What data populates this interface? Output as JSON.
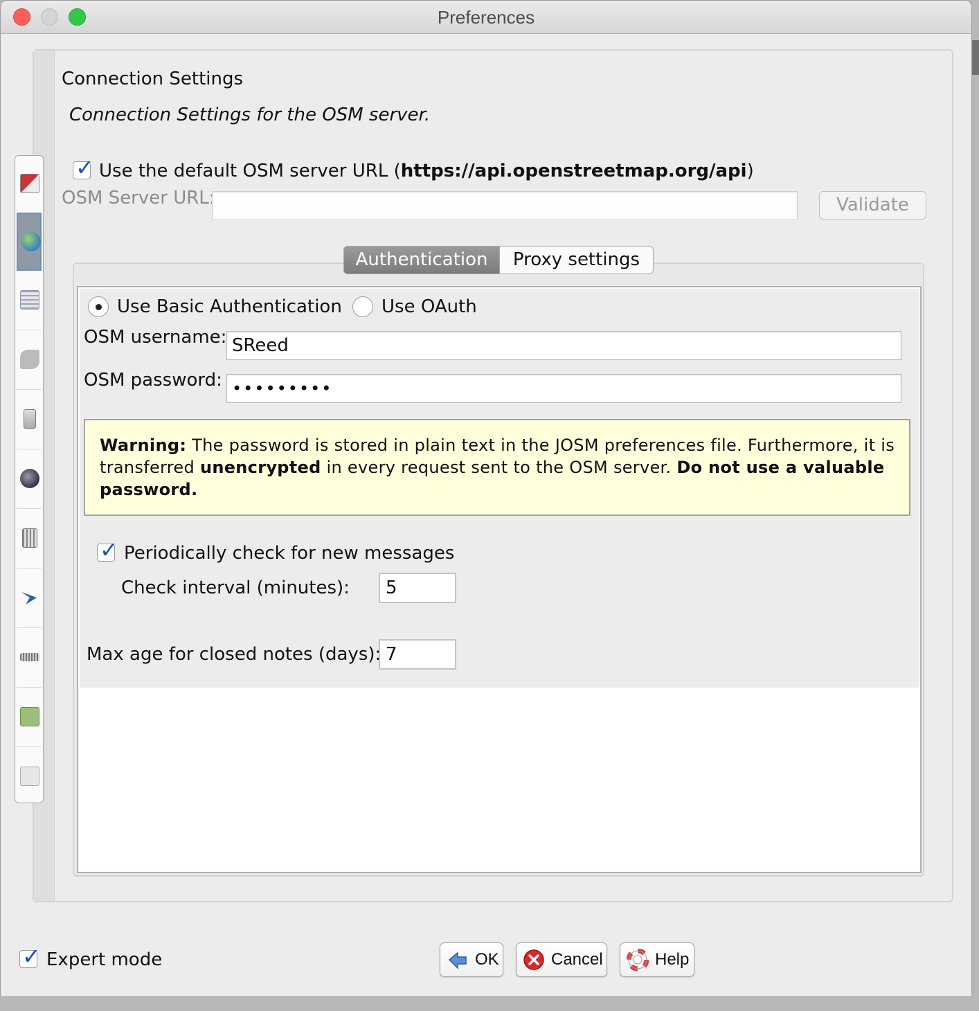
{
  "window": {
    "title": "Preferences"
  },
  "header": {
    "title": "Connection Settings",
    "subtitle": "Connection Settings for the OSM server."
  },
  "server": {
    "use_default_prefix": "Use the default OSM server URL (",
    "default_url": "https://api.openstreetmap.org/api",
    "use_default_suffix": ")",
    "use_default_checked": true,
    "url_label": "OSM Server URL:",
    "url_value": "",
    "validate_label": "Validate"
  },
  "tabs": [
    {
      "label": "Authentication",
      "selected": true
    },
    {
      "label": "Proxy settings",
      "selected": false
    }
  ],
  "auth": {
    "basic_label": "Use Basic Authentication",
    "oauth_label": "Use OAuth",
    "basic_selected": true,
    "username_label": "OSM username:",
    "username_value": "SReed",
    "password_label": "OSM password:",
    "password_value": "•••••••••",
    "warning": {
      "w_bold": "Warning:",
      "w_text1": " The password is stored in plain text in the JOSM preferences file. Furthermore, it is transferred ",
      "w_bold2": "unencrypted",
      "w_text2": " in every request sent to the OSM server. ",
      "w_bold3": "Do not use a valuable password."
    }
  },
  "messages": {
    "periodic_label": "Periodically check for new messages",
    "periodic_checked": true,
    "interval_label": "Check interval (minutes):",
    "interval_value": "5",
    "max_age_label": "Max age for closed notes (days):",
    "max_age_value": "7"
  },
  "sidebar": {
    "items": [
      {
        "icon": "display-settings-icon"
      },
      {
        "icon": "connection-globe-icon",
        "selected": true
      },
      {
        "icon": "map-grid-icon"
      },
      {
        "icon": "map-paint-styles-icon"
      },
      {
        "icon": "tagging-presets-icon"
      },
      {
        "icon": "remote-control-icon"
      },
      {
        "icon": "shortcuts-keyboard-icon"
      },
      {
        "icon": "validator-arrow-icon"
      },
      {
        "icon": "audio-settings-icon"
      },
      {
        "icon": "wms-tms-icon"
      },
      {
        "icon": "plugins-icon"
      }
    ]
  },
  "footer": {
    "expert_label": "Expert mode",
    "expert_checked": true,
    "ok_label": "OK",
    "cancel_label": "Cancel",
    "help_label": "Help"
  },
  "colors": {
    "accent_check": "#1a4fb5",
    "warning_bg": "#ffffdc",
    "tab_selected": "#8a8a8a"
  }
}
